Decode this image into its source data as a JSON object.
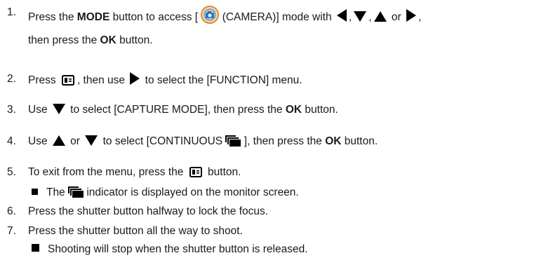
{
  "steps": [
    {
      "num": "1.",
      "a": "Press the ",
      "b1": "MODE",
      "c": " button to access [",
      "d": " (CAMERA)] mode with ",
      "e": " or ",
      "f": ",",
      "g": "then press the ",
      "b2": "OK",
      "h": " button."
    },
    {
      "num": "2.",
      "a": "Press ",
      "b": ", then use ",
      "c": " to select the [FUNCTION] menu."
    },
    {
      "num": "3.",
      "a": "Use ",
      "b": " to select [CAPTURE MODE], then press the ",
      "bold": "OK",
      "c": " button."
    },
    {
      "num": "4.",
      "a": "Use ",
      "b": " or ",
      "c": " to select [CONTINUOUS ",
      "d": " ], then press the ",
      "bold": "OK",
      "e": " button."
    },
    {
      "num": "5.",
      "a": "To exit from the menu, press the ",
      "b": " button."
    },
    {
      "num": "6.",
      "a": "Press the shutter button halfway to lock the focus."
    },
    {
      "num": "7.",
      "a": "Press the shutter button all the way to shoot."
    }
  ],
  "notes": {
    "step5": {
      "a": "The ",
      "b": " indicator is displayed on the monitor screen."
    },
    "step7": {
      "a": "Shooting will stop when the shutter button is released."
    }
  },
  "icons": [
    "camera-mode-icon",
    "left-arrow-icon",
    "down-arrow-icon",
    "up-arrow-icon",
    "right-arrow-icon",
    "menu-button-icon",
    "continuous-shooting-icon",
    "bullet-icon"
  ]
}
